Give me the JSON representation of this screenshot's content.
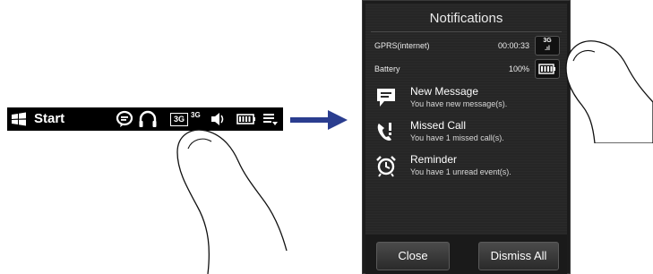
{
  "taskbar": {
    "start_label": "Start",
    "network_3g_label": "3G",
    "signal_3g_label": "3G"
  },
  "notifications": {
    "title": "Notifications",
    "gprs": {
      "label": "GPRS(internet)",
      "value": "00:00:33",
      "icon_label": "3G"
    },
    "battery": {
      "label": "Battery",
      "value": "100%"
    },
    "items": [
      {
        "title": "New Message",
        "subtitle": "You have new message(s).",
        "icon": "message-icon"
      },
      {
        "title": "Missed Call",
        "subtitle": "You have 1 missed call(s).",
        "icon": "missed-call-icon"
      },
      {
        "title": "Reminder",
        "subtitle": "You have 1 unread event(s).",
        "icon": "alarm-clock-icon"
      }
    ],
    "close_label": "Close",
    "dismiss_all_label": "Dismiss All"
  },
  "colors": {
    "arrow": "#2a3d8f",
    "taskbar_bg": "#000000",
    "panel_bg": "#262626"
  }
}
